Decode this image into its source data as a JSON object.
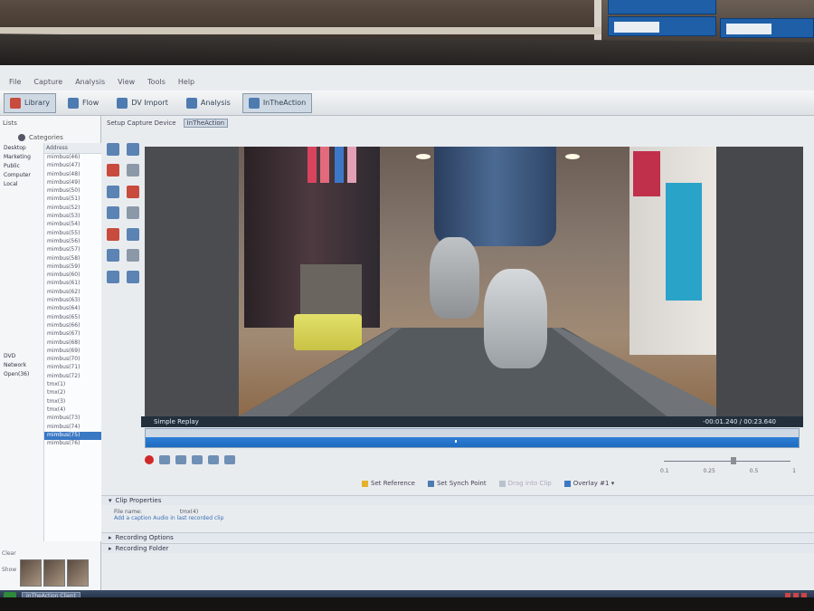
{
  "menu": [
    "File",
    "Capture",
    "Analysis",
    "View",
    "Tools",
    "Help"
  ],
  "toolbar": {
    "tabs": [
      {
        "label": "Library"
      },
      {
        "label": "Flow"
      },
      {
        "label": "DV Import"
      },
      {
        "label": "Analysis"
      },
      {
        "label": "InTheAction"
      }
    ]
  },
  "subbar": {
    "setup_capture": "Setup Capture Device",
    "active_view": "InTheAction"
  },
  "left_panel": {
    "header": "Lists",
    "categories_label": "Categories",
    "address_label": "Address",
    "tree": [
      "Desktop",
      "Marketing",
      "Public",
      "Computer",
      "Local",
      "DVD",
      "Network",
      "Open(36)"
    ],
    "files": [
      "mimbus(46)",
      "mimbus(47)",
      "mimbus(48)",
      "mimbus(49)",
      "mimbus(50)",
      "mimbus(51)",
      "mimbus(52)",
      "mimbus(53)",
      "mimbus(54)",
      "mimbus(55)",
      "mimbus(56)",
      "mimbus(57)",
      "mimbus(58)",
      "mimbus(59)",
      "mimbus(60)",
      "mimbus(61)",
      "mimbus(62)",
      "mimbus(63)",
      "mimbus(64)",
      "mimbus(65)",
      "mimbus(66)",
      "mimbus(67)",
      "mimbus(68)",
      "mimbus(69)",
      "mimbus(70)",
      "mimbus(71)",
      "mimbus(72)",
      "tmx(1)",
      "tmx(2)",
      "tmx(3)",
      "tmx(4)",
      "mimbus(73)",
      "mimbus(74)",
      "mimbus(75)",
      "mimbus(76)"
    ],
    "selected_index": 33,
    "bottom_labels": [
      "Clear",
      "Show"
    ]
  },
  "replay": {
    "title": "Simple Replay",
    "time": "-00:01.240 / 00:23.640"
  },
  "slider": {
    "ticks": [
      "0.1",
      "0.25",
      "0.5",
      "1"
    ]
  },
  "actions": {
    "set_reference": "Set Reference",
    "set_synch_point": "Set Synch Point",
    "drag_into_clip": "Drag into Clip",
    "overlay": "Overlay #1"
  },
  "clip_properties": {
    "header": "Clip Properties",
    "file_name_label": "File name:",
    "file_name_value": "tmx(4)",
    "link_text": "Add a caption   Audio in last recorded clip"
  },
  "recording_options": {
    "header": "Recording Options"
  },
  "recording_folder": {
    "header": "Recording Folder"
  },
  "right_note": "Recording Options",
  "taskbar": {
    "task_label": "InTheAction Client"
  },
  "colors": {
    "accent_blue": "#2d7fd6",
    "record_red": "#d12929",
    "replay_bar": "#23303c"
  }
}
